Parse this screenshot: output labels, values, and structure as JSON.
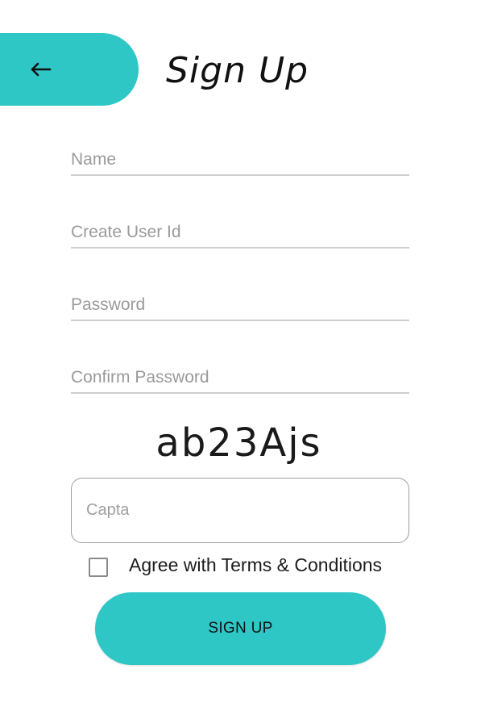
{
  "header": {
    "back_icon": "arrow-left-icon",
    "title": "Sign Up"
  },
  "form": {
    "name": {
      "placeholder": "Name",
      "value": ""
    },
    "user_id": {
      "placeholder": "Create User Id",
      "value": ""
    },
    "password": {
      "placeholder": "Password",
      "value": ""
    },
    "confirm_password": {
      "placeholder": "Confirm Password",
      "value": ""
    },
    "captcha_code": "ab23Ajs",
    "captcha": {
      "placeholder": "Capta",
      "value": ""
    },
    "terms": {
      "label": "Agree with Terms & Conditions",
      "checked": false
    },
    "submit_label": "SIGN UP"
  },
  "colors": {
    "accent": "#2fc6c6",
    "underline": "#cfcfcf",
    "placeholder": "#9a9a9a",
    "text": "#111111"
  }
}
